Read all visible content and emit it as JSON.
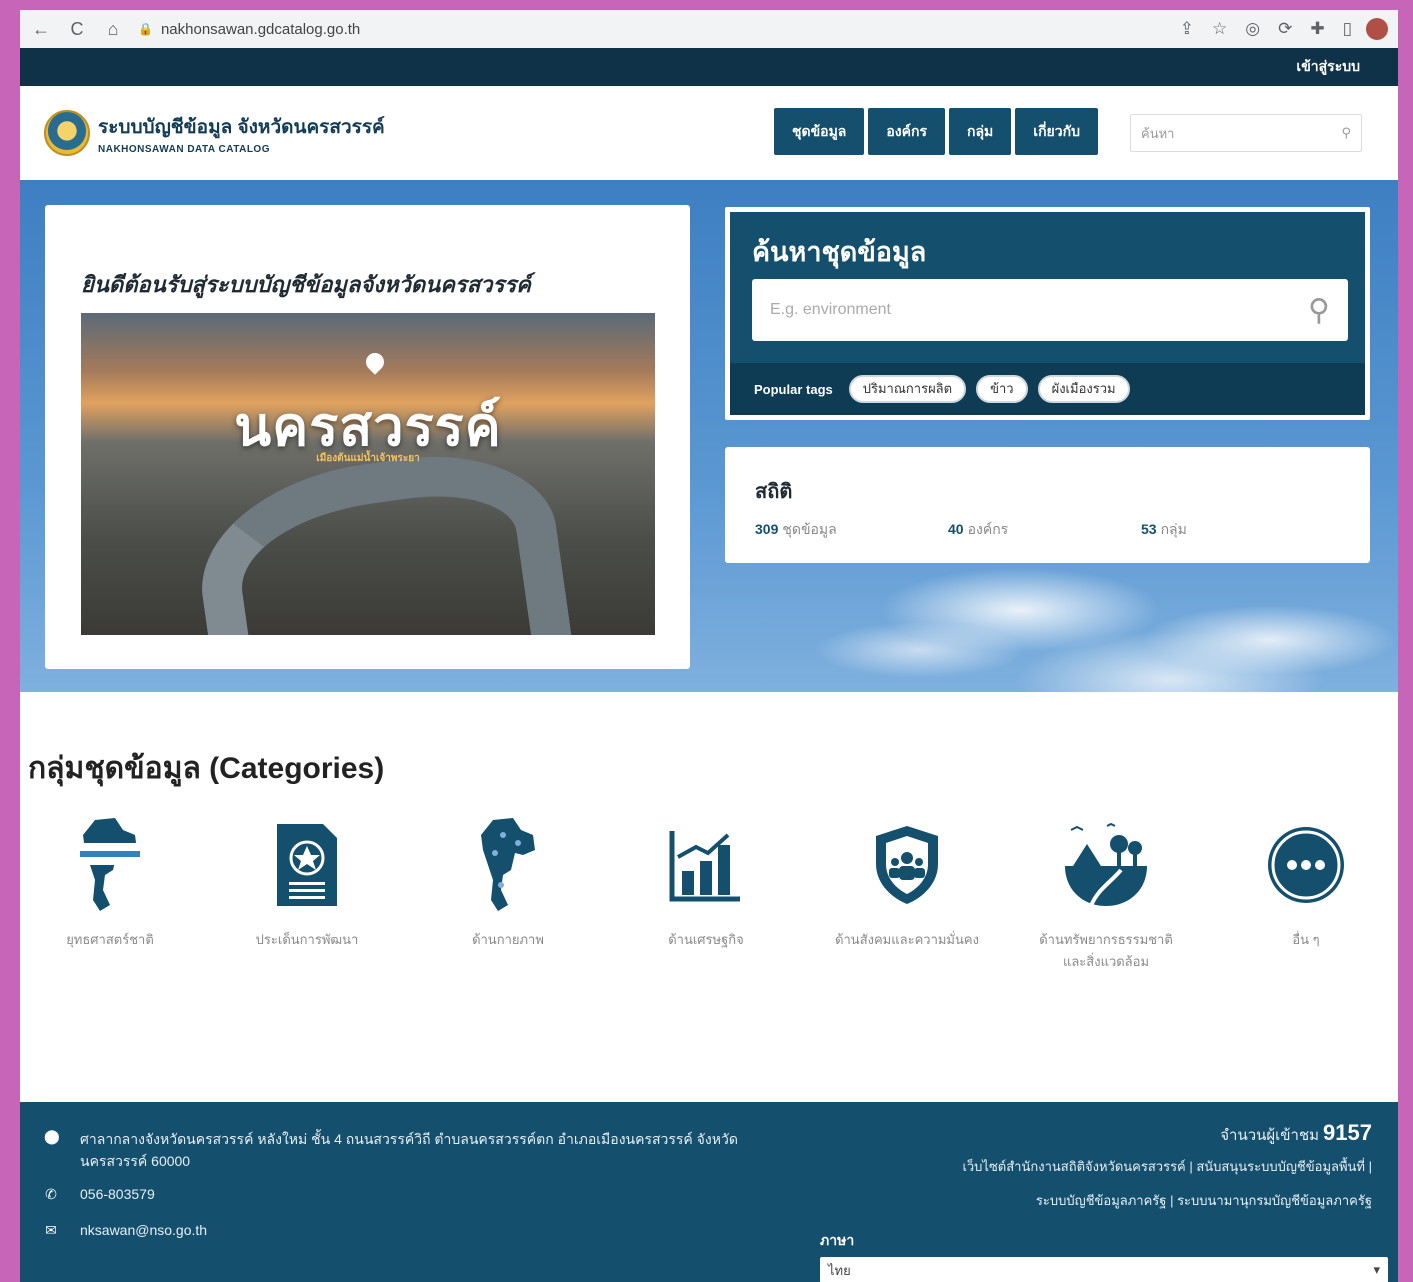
{
  "browser": {
    "url": "nakhonsawan.gdcatalog.go.th",
    "back": "←",
    "reload": "C",
    "home": "⌂"
  },
  "topbar": {
    "login": "เข้าสู่ระบบ"
  },
  "header": {
    "brand_th": "ระบบบัญชีข้อมูล จังหวัดนครสวรรค์",
    "brand_en": "NAKHONSAWAN DATA CATALOG",
    "nav": [
      "ชุดข้อมูล",
      "องค์กร",
      "กลุ่ม",
      "เกี่ยวกับ"
    ],
    "search_placeholder": "ค้นหา"
  },
  "hero": {
    "welcome": "ยินดีต้อนรับสู่ระบบบัญชีข้อมูลจังหวัดนครสวรรค์",
    "image_title": "นครสวรรค์",
    "image_subtitle": "เมืองต้นแม่น้ำเจ้าพระยา",
    "search_title": "ค้นหาชุดข้อมูล",
    "search_placeholder": "E.g. environment",
    "popular_tags_label": "Popular tags",
    "tags": [
      "ปริมาณการผลิต",
      "ข้าว",
      "ผังเมืองรวม"
    ],
    "stats_title": "สถิติ",
    "stats": [
      {
        "count": "309",
        "label": "ชุดข้อมูล"
      },
      {
        "count": "40",
        "label": "องค์กร"
      },
      {
        "count": "53",
        "label": "กลุ่ม"
      }
    ]
  },
  "categories": {
    "title": "กลุ่มชุดข้อมูล (Categories)",
    "items": [
      {
        "label": "ยุทธศาสตร์ชาติ",
        "icon": "thailand-flag-map-icon"
      },
      {
        "label": "ประเด็นการพัฒนา",
        "icon": "document-emblem-icon"
      },
      {
        "label": "ด้านกายภาพ",
        "icon": "thailand-map-icon"
      },
      {
        "label": "ด้านเศรษฐกิจ",
        "icon": "bar-chart-icon"
      },
      {
        "label": "ด้านสังคมและความมั่นคง",
        "icon": "people-shield-icon"
      },
      {
        "label": "ด้านทรัพยากรธรรมชาติ",
        "label2": "และสิ่งแวดล้อม",
        "icon": "environment-icon"
      },
      {
        "label": "อื่น ๆ",
        "icon": "more-icon"
      }
    ]
  },
  "footer": {
    "address": "ศาลากลางจังหวัดนครสวรรค์ หลังใหม่ ชั้น 4 ถนนสวรรค์วิถี ตำบลนครสวรรค์ตก อำเภอเมืองนครสวรรค์ จังหวัดนครสวรรค์ 60000",
    "phone": "056-803579",
    "email": "nksawan@nso.go.th",
    "visits_label": "จำนวนผู้เข้าชม",
    "visits": "9157",
    "links1": "เว็บไซต์สำนักงานสถิติจังหวัดนครสวรรค์ | สนับสนุนระบบบัญชีข้อมูลพื้นที่ |",
    "links2": "ระบบบัญชีข้อมูลภาครัฐ | ระบบนามานุกรมบัญชีข้อมูลภาครัฐ",
    "language_label": "ภาษา",
    "language_value": "ไทย"
  },
  "colors": {
    "primary": "#14506e",
    "topbar": "#0f3249",
    "frame": "#c766b8"
  }
}
